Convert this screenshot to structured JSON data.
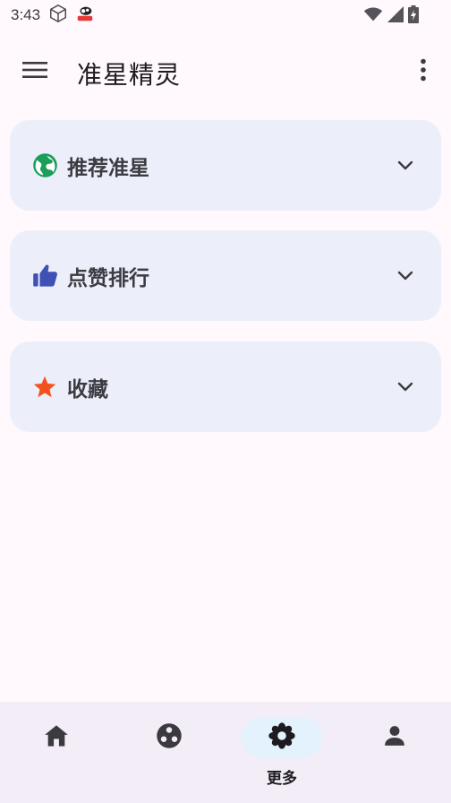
{
  "status_bar": {
    "time": "3:43",
    "icons": [
      "box-icon",
      "game-app-icon",
      "wifi-icon",
      "signal-icon",
      "battery-charging-icon"
    ]
  },
  "app_bar": {
    "title": "准星精灵",
    "menu_icon": "hamburger-menu-icon",
    "overflow_icon": "more-vert-icon"
  },
  "cards": [
    {
      "label": "推荐准星",
      "icon": "globe-icon",
      "icon_color": "#1a9e5a"
    },
    {
      "label": "点赞排行",
      "icon": "thumb-up-icon",
      "icon_color": "#3f51b5"
    },
    {
      "label": "收藏",
      "icon": "star-icon",
      "icon_color": "#f4511e"
    }
  ],
  "bottom_nav": {
    "items": [
      {
        "name": "home",
        "icon": "home-icon",
        "label": ""
      },
      {
        "name": "discover",
        "icon": "circles-icon",
        "label": ""
      },
      {
        "name": "more",
        "icon": "flower-icon",
        "label": "更多",
        "active": true
      },
      {
        "name": "profile",
        "icon": "person-icon",
        "label": ""
      }
    ]
  },
  "colors": {
    "background": "#fff8fd",
    "card": "#eceff9",
    "nav_background": "#f3edf7",
    "nav_active_pill": "#e3f2fd"
  }
}
